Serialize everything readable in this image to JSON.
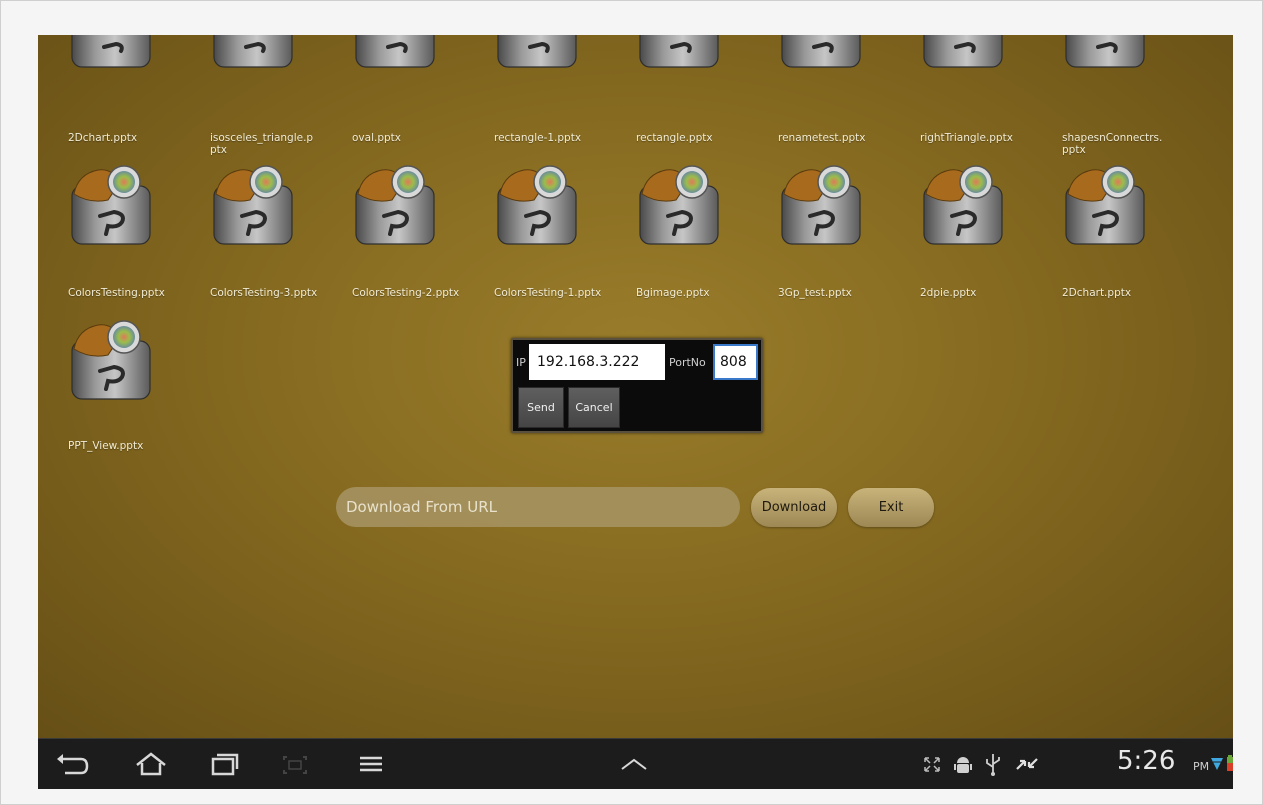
{
  "files_row1": [
    "2Dchart.pptx",
    "isosceles_triangle.pptx",
    "oval.pptx",
    "rectangle-1.pptx",
    "rectangle.pptx",
    "renametest.pptx",
    "rightTriangle.pptx",
    "shapesnConnectrs.pptx"
  ],
  "files_row2": [
    "ColorsTesting.pptx",
    "ColorsTesting-3.pptx",
    "ColorsTesting-2.pptx",
    "ColorsTesting-1.pptx",
    "Bgimage.pptx",
    "3Gp_test.pptx",
    "2dpie.pptx",
    "2Dchart.pptx"
  ],
  "files_row3": [
    "PPT_View.pptx"
  ],
  "dialog": {
    "ip_label": "IP",
    "ip_value": "192.168.3.222",
    "port_label": "PortNo",
    "port_value": "808",
    "send": "Send",
    "cancel": "Cancel"
  },
  "url_placeholder": "Download From URL",
  "download": "Download",
  "exit": "Exit",
  "status": {
    "time": "5:26",
    "ampm": "PM"
  },
  "icons": [
    "back-icon",
    "home-icon",
    "recent-apps-icon",
    "screenshot-icon",
    "menu-icon",
    "up-chevron-icon",
    "resize-icon",
    "android-icon",
    "usb-icon",
    "sync-icon",
    "wifi-icon",
    "battery-icon"
  ]
}
